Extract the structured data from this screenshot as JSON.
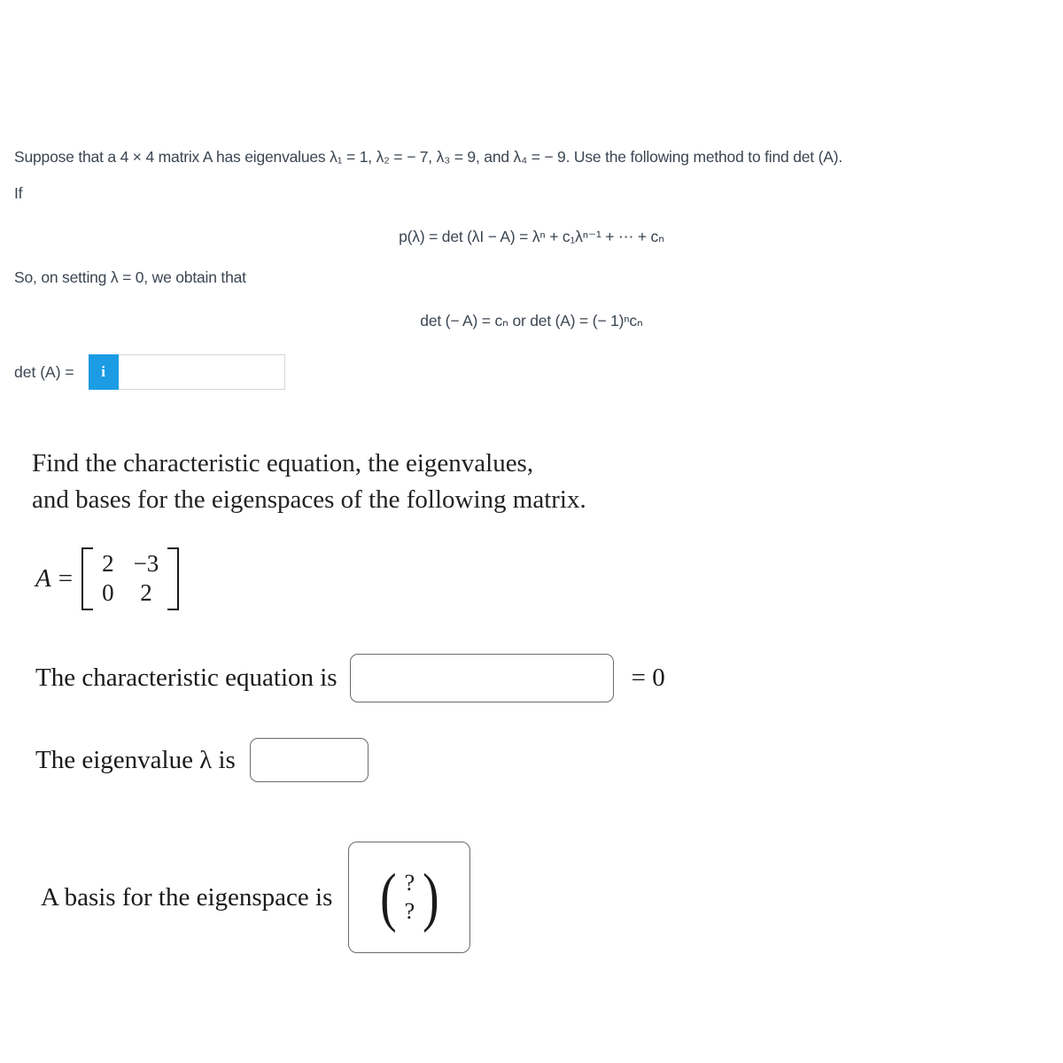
{
  "problem_top": {
    "intro_prefix": "Suppose that a 4 × 4 matrix A has eigenvalues ",
    "eigenvalue_assignments": "λ₁ = 1, λ₂ = − 7, λ₃ = 9, and λ₄ = − 9.",
    "intro_suffix": " Use the following method to find det (A).",
    "if_label": "If",
    "formula_characteristic_polynomial": "p(λ) = det (λI − A) = λⁿ + c₁λⁿ⁻¹ + ⋯ + cₙ",
    "setting_lambda_zero": "So, on setting λ = 0, we obtain that",
    "formula_determinant": "det (− A) = cₙ or det (A) = (− 1)ⁿcₙ",
    "det_answer_label": "det (A) =",
    "info_button_glyph": "i",
    "det_answer_value": "",
    "det_answer_placeholder": ""
  },
  "question": {
    "heading_line_1": "Find the characteristic equation, the eigenvalues,",
    "heading_line_2": "and bases for the eigenspaces of the following matrix.",
    "matrix_label": "A",
    "equals_sign": "=",
    "matrix_rows": [
      [
        "2",
        "−3"
      ],
      [
        "0",
        "2"
      ]
    ],
    "characteristic_equation_label": "The characteristic equation is",
    "characteristic_equation_value": "",
    "characteristic_equation_rhs": "= 0",
    "eigenvalue_label": "The eigenvalue λ is",
    "eigenvalue_value": "",
    "basis_label": "A basis for the eigenspace is",
    "basis_vector_entries": [
      "?",
      "?"
    ]
  },
  "colors": {
    "info_button_blue": "#1b9ce4",
    "sans_text": "#3c4652",
    "serif_text": "#1a1a1a",
    "box_border": "#6b6b6b",
    "field_border": "#d3d7db",
    "page_background": "#ffffff"
  }
}
